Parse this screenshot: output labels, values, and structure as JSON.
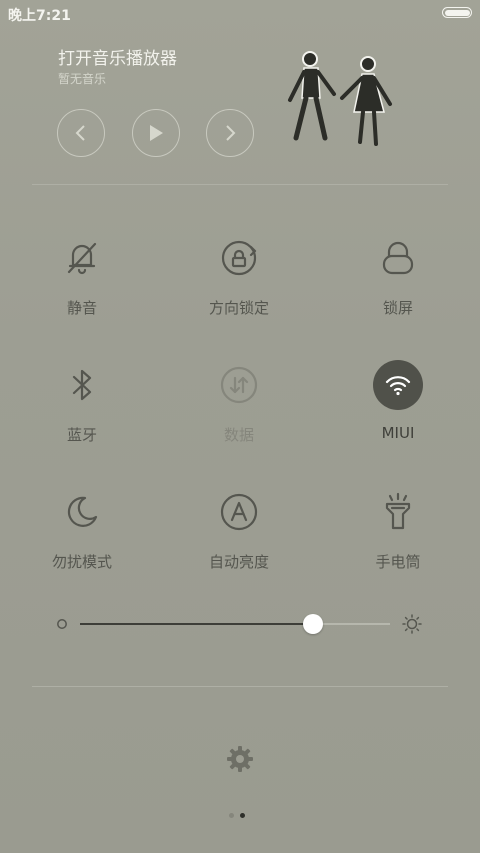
{
  "status_bar": {
    "time": "晚上7:21",
    "battery_level": 1.0
  },
  "music_player": {
    "title": "打开音乐播放器",
    "subtitle": "暂无音乐",
    "controls": [
      "previous-icon",
      "play-icon",
      "next-icon"
    ]
  },
  "toggles": [
    {
      "label": "静音",
      "icon": "bell-off-icon",
      "state": "off"
    },
    {
      "label": "方向锁定",
      "icon": "rotation-lock-icon",
      "state": "off"
    },
    {
      "label": "锁屏",
      "icon": "lock-icon",
      "state": "off"
    },
    {
      "label": "蓝牙",
      "icon": "bluetooth-icon",
      "state": "off"
    },
    {
      "label": "数据",
      "icon": "mobile-data-icon",
      "state": "disabled"
    },
    {
      "label": "MIUI",
      "icon": "wifi-icon",
      "state": "on"
    },
    {
      "label": "勿扰模式",
      "icon": "moon-icon",
      "state": "off"
    },
    {
      "label": "自动亮度",
      "icon": "auto-brightness-icon",
      "state": "off"
    },
    {
      "label": "手电筒",
      "icon": "flashlight-icon",
      "state": "off"
    }
  ],
  "brightness": {
    "level": 0.75
  },
  "page_indicator": {
    "pages": 2,
    "current": 2
  },
  "colors": {
    "background": "#9c9d92",
    "icon": "#55564f",
    "active_bg": "#50514a",
    "active_icon": "#ffffff"
  }
}
